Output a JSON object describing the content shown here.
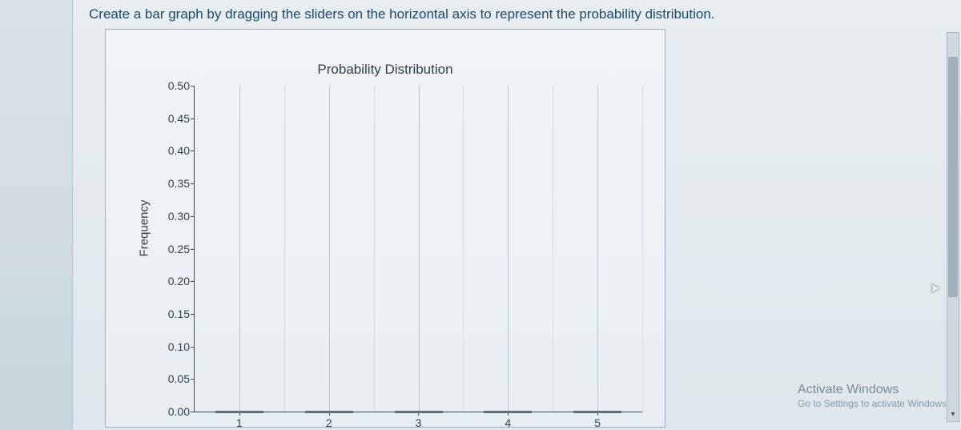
{
  "instruction": "Create a bar graph by dragging the sliders on the horizontal axis to represent the probability distribution.",
  "chart": {
    "title": "Probability Distribution",
    "ylabel": "Frequency",
    "y_ticks": [
      "0.50",
      "0.45",
      "0.40",
      "0.35",
      "0.30",
      "0.25",
      "0.20",
      "0.15",
      "0.10",
      "0.05",
      "0.00"
    ],
    "x_ticks": [
      "1",
      "2",
      "3",
      "4",
      "5"
    ]
  },
  "watermark": {
    "title": "Activate Windows",
    "sub": "Go to Settings to activate Windows"
  },
  "chart_data": {
    "type": "bar",
    "title": "Probability Distribution",
    "xlabel": "",
    "ylabel": "Frequency",
    "ylim": [
      0,
      0.5
    ],
    "categories": [
      "1",
      "2",
      "3",
      "4",
      "5"
    ],
    "values": [
      0,
      0,
      0,
      0,
      0
    ]
  }
}
